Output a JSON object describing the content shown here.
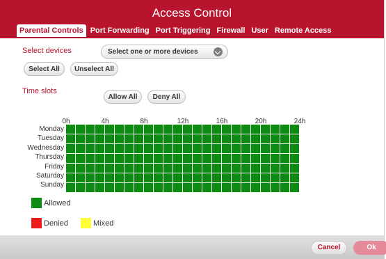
{
  "dialog": {
    "title": "Access Control"
  },
  "tabs": [
    {
      "label": "Parental Controls",
      "active": true
    },
    {
      "label": "Port Forwarding",
      "active": false
    },
    {
      "label": "Port Triggering",
      "active": false
    },
    {
      "label": "Firewall",
      "active": false
    },
    {
      "label": "User",
      "active": false
    },
    {
      "label": "Remote Access",
      "active": false
    }
  ],
  "devices": {
    "label": "Select devices",
    "dropdown_value": "Select one or more devices",
    "select_all": "Select All",
    "unselect_all": "Unselect All"
  },
  "time_slots": {
    "label": "Time slots",
    "allow_all": "Allow All",
    "deny_all": "Deny All"
  },
  "schedule": {
    "hour_labels": [
      "0h",
      "4h",
      "8h",
      "12h",
      "16h",
      "20h",
      "24h"
    ],
    "days": [
      "Monday",
      "Tuesday",
      "Wednesday",
      "Thursday",
      "Friday",
      "Saturday",
      "Sunday"
    ],
    "slots_per_day": 24,
    "state": "allowed"
  },
  "legend": {
    "allowed": "Allowed",
    "denied": "Denied",
    "mixed": "Mixed"
  },
  "colors": {
    "brand": "#b8142e",
    "allowed": "#0d8a12",
    "denied": "#ee1b1b",
    "mixed": "#ffff33"
  },
  "footer": {
    "cancel": "Cancel",
    "ok": "Ok"
  }
}
